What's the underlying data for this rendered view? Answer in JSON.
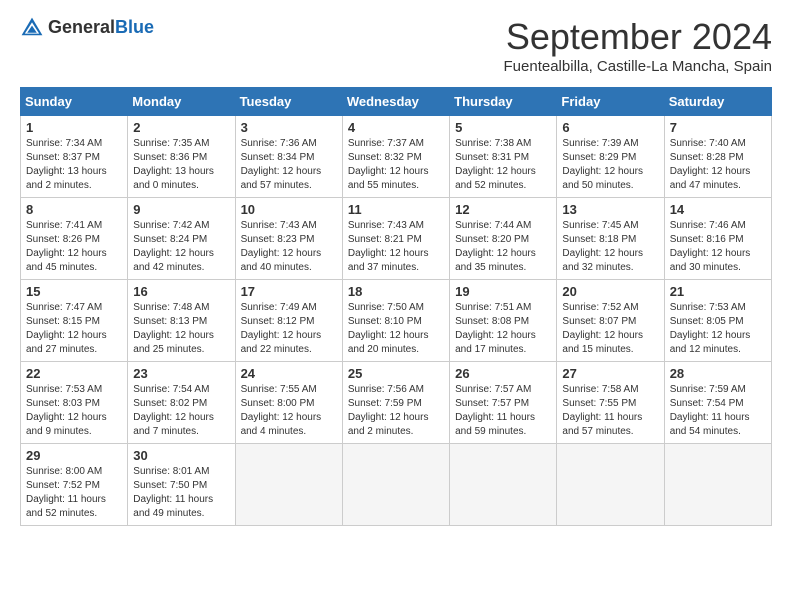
{
  "logo": {
    "text1": "General",
    "text2": "Blue"
  },
  "title": "September 2024",
  "location": "Fuentealbilla, Castille-La Mancha, Spain",
  "headers": [
    "Sunday",
    "Monday",
    "Tuesday",
    "Wednesday",
    "Thursday",
    "Friday",
    "Saturday"
  ],
  "weeks": [
    [
      {
        "num": "1",
        "info": "Sunrise: 7:34 AM\nSunset: 8:37 PM\nDaylight: 13 hours\nand 2 minutes."
      },
      {
        "num": "2",
        "info": "Sunrise: 7:35 AM\nSunset: 8:36 PM\nDaylight: 13 hours\nand 0 minutes."
      },
      {
        "num": "3",
        "info": "Sunrise: 7:36 AM\nSunset: 8:34 PM\nDaylight: 12 hours\nand 57 minutes."
      },
      {
        "num": "4",
        "info": "Sunrise: 7:37 AM\nSunset: 8:32 PM\nDaylight: 12 hours\nand 55 minutes."
      },
      {
        "num": "5",
        "info": "Sunrise: 7:38 AM\nSunset: 8:31 PM\nDaylight: 12 hours\nand 52 minutes."
      },
      {
        "num": "6",
        "info": "Sunrise: 7:39 AM\nSunset: 8:29 PM\nDaylight: 12 hours\nand 50 minutes."
      },
      {
        "num": "7",
        "info": "Sunrise: 7:40 AM\nSunset: 8:28 PM\nDaylight: 12 hours\nand 47 minutes."
      }
    ],
    [
      {
        "num": "8",
        "info": "Sunrise: 7:41 AM\nSunset: 8:26 PM\nDaylight: 12 hours\nand 45 minutes."
      },
      {
        "num": "9",
        "info": "Sunrise: 7:42 AM\nSunset: 8:24 PM\nDaylight: 12 hours\nand 42 minutes."
      },
      {
        "num": "10",
        "info": "Sunrise: 7:43 AM\nSunset: 8:23 PM\nDaylight: 12 hours\nand 40 minutes."
      },
      {
        "num": "11",
        "info": "Sunrise: 7:43 AM\nSunset: 8:21 PM\nDaylight: 12 hours\nand 37 minutes."
      },
      {
        "num": "12",
        "info": "Sunrise: 7:44 AM\nSunset: 8:20 PM\nDaylight: 12 hours\nand 35 minutes."
      },
      {
        "num": "13",
        "info": "Sunrise: 7:45 AM\nSunset: 8:18 PM\nDaylight: 12 hours\nand 32 minutes."
      },
      {
        "num": "14",
        "info": "Sunrise: 7:46 AM\nSunset: 8:16 PM\nDaylight: 12 hours\nand 30 minutes."
      }
    ],
    [
      {
        "num": "15",
        "info": "Sunrise: 7:47 AM\nSunset: 8:15 PM\nDaylight: 12 hours\nand 27 minutes."
      },
      {
        "num": "16",
        "info": "Sunrise: 7:48 AM\nSunset: 8:13 PM\nDaylight: 12 hours\nand 25 minutes."
      },
      {
        "num": "17",
        "info": "Sunrise: 7:49 AM\nSunset: 8:12 PM\nDaylight: 12 hours\nand 22 minutes."
      },
      {
        "num": "18",
        "info": "Sunrise: 7:50 AM\nSunset: 8:10 PM\nDaylight: 12 hours\nand 20 minutes."
      },
      {
        "num": "19",
        "info": "Sunrise: 7:51 AM\nSunset: 8:08 PM\nDaylight: 12 hours\nand 17 minutes."
      },
      {
        "num": "20",
        "info": "Sunrise: 7:52 AM\nSunset: 8:07 PM\nDaylight: 12 hours\nand 15 minutes."
      },
      {
        "num": "21",
        "info": "Sunrise: 7:53 AM\nSunset: 8:05 PM\nDaylight: 12 hours\nand 12 minutes."
      }
    ],
    [
      {
        "num": "22",
        "info": "Sunrise: 7:53 AM\nSunset: 8:03 PM\nDaylight: 12 hours\nand 9 minutes."
      },
      {
        "num": "23",
        "info": "Sunrise: 7:54 AM\nSunset: 8:02 PM\nDaylight: 12 hours\nand 7 minutes."
      },
      {
        "num": "24",
        "info": "Sunrise: 7:55 AM\nSunset: 8:00 PM\nDaylight: 12 hours\nand 4 minutes."
      },
      {
        "num": "25",
        "info": "Sunrise: 7:56 AM\nSunset: 7:59 PM\nDaylight: 12 hours\nand 2 minutes."
      },
      {
        "num": "26",
        "info": "Sunrise: 7:57 AM\nSunset: 7:57 PM\nDaylight: 11 hours\nand 59 minutes."
      },
      {
        "num": "27",
        "info": "Sunrise: 7:58 AM\nSunset: 7:55 PM\nDaylight: 11 hours\nand 57 minutes."
      },
      {
        "num": "28",
        "info": "Sunrise: 7:59 AM\nSunset: 7:54 PM\nDaylight: 11 hours\nand 54 minutes."
      }
    ],
    [
      {
        "num": "29",
        "info": "Sunrise: 8:00 AM\nSunset: 7:52 PM\nDaylight: 11 hours\nand 52 minutes."
      },
      {
        "num": "30",
        "info": "Sunrise: 8:01 AM\nSunset: 7:50 PM\nDaylight: 11 hours\nand 49 minutes."
      },
      {
        "num": "",
        "info": ""
      },
      {
        "num": "",
        "info": ""
      },
      {
        "num": "",
        "info": ""
      },
      {
        "num": "",
        "info": ""
      },
      {
        "num": "",
        "info": ""
      }
    ]
  ]
}
